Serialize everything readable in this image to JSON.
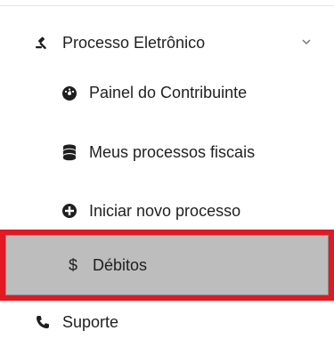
{
  "menu": {
    "parent": {
      "label": "Processo Eletrônico",
      "icon": "gavel-icon",
      "expanded": true
    },
    "items": [
      {
        "label": "Painel do Contribuinte",
        "icon": "dashboard-icon"
      },
      {
        "label": "Meus processos fiscais",
        "icon": "database-icon"
      },
      {
        "label": "Iniciar novo processo",
        "icon": "plus-circle-icon"
      },
      {
        "label": "Débitos",
        "icon": "dollar-icon",
        "symbol": "$",
        "selected": true,
        "highlight_color": "#e11923"
      }
    ],
    "support": {
      "label": "Suporte",
      "icon": "phone-icon"
    }
  }
}
